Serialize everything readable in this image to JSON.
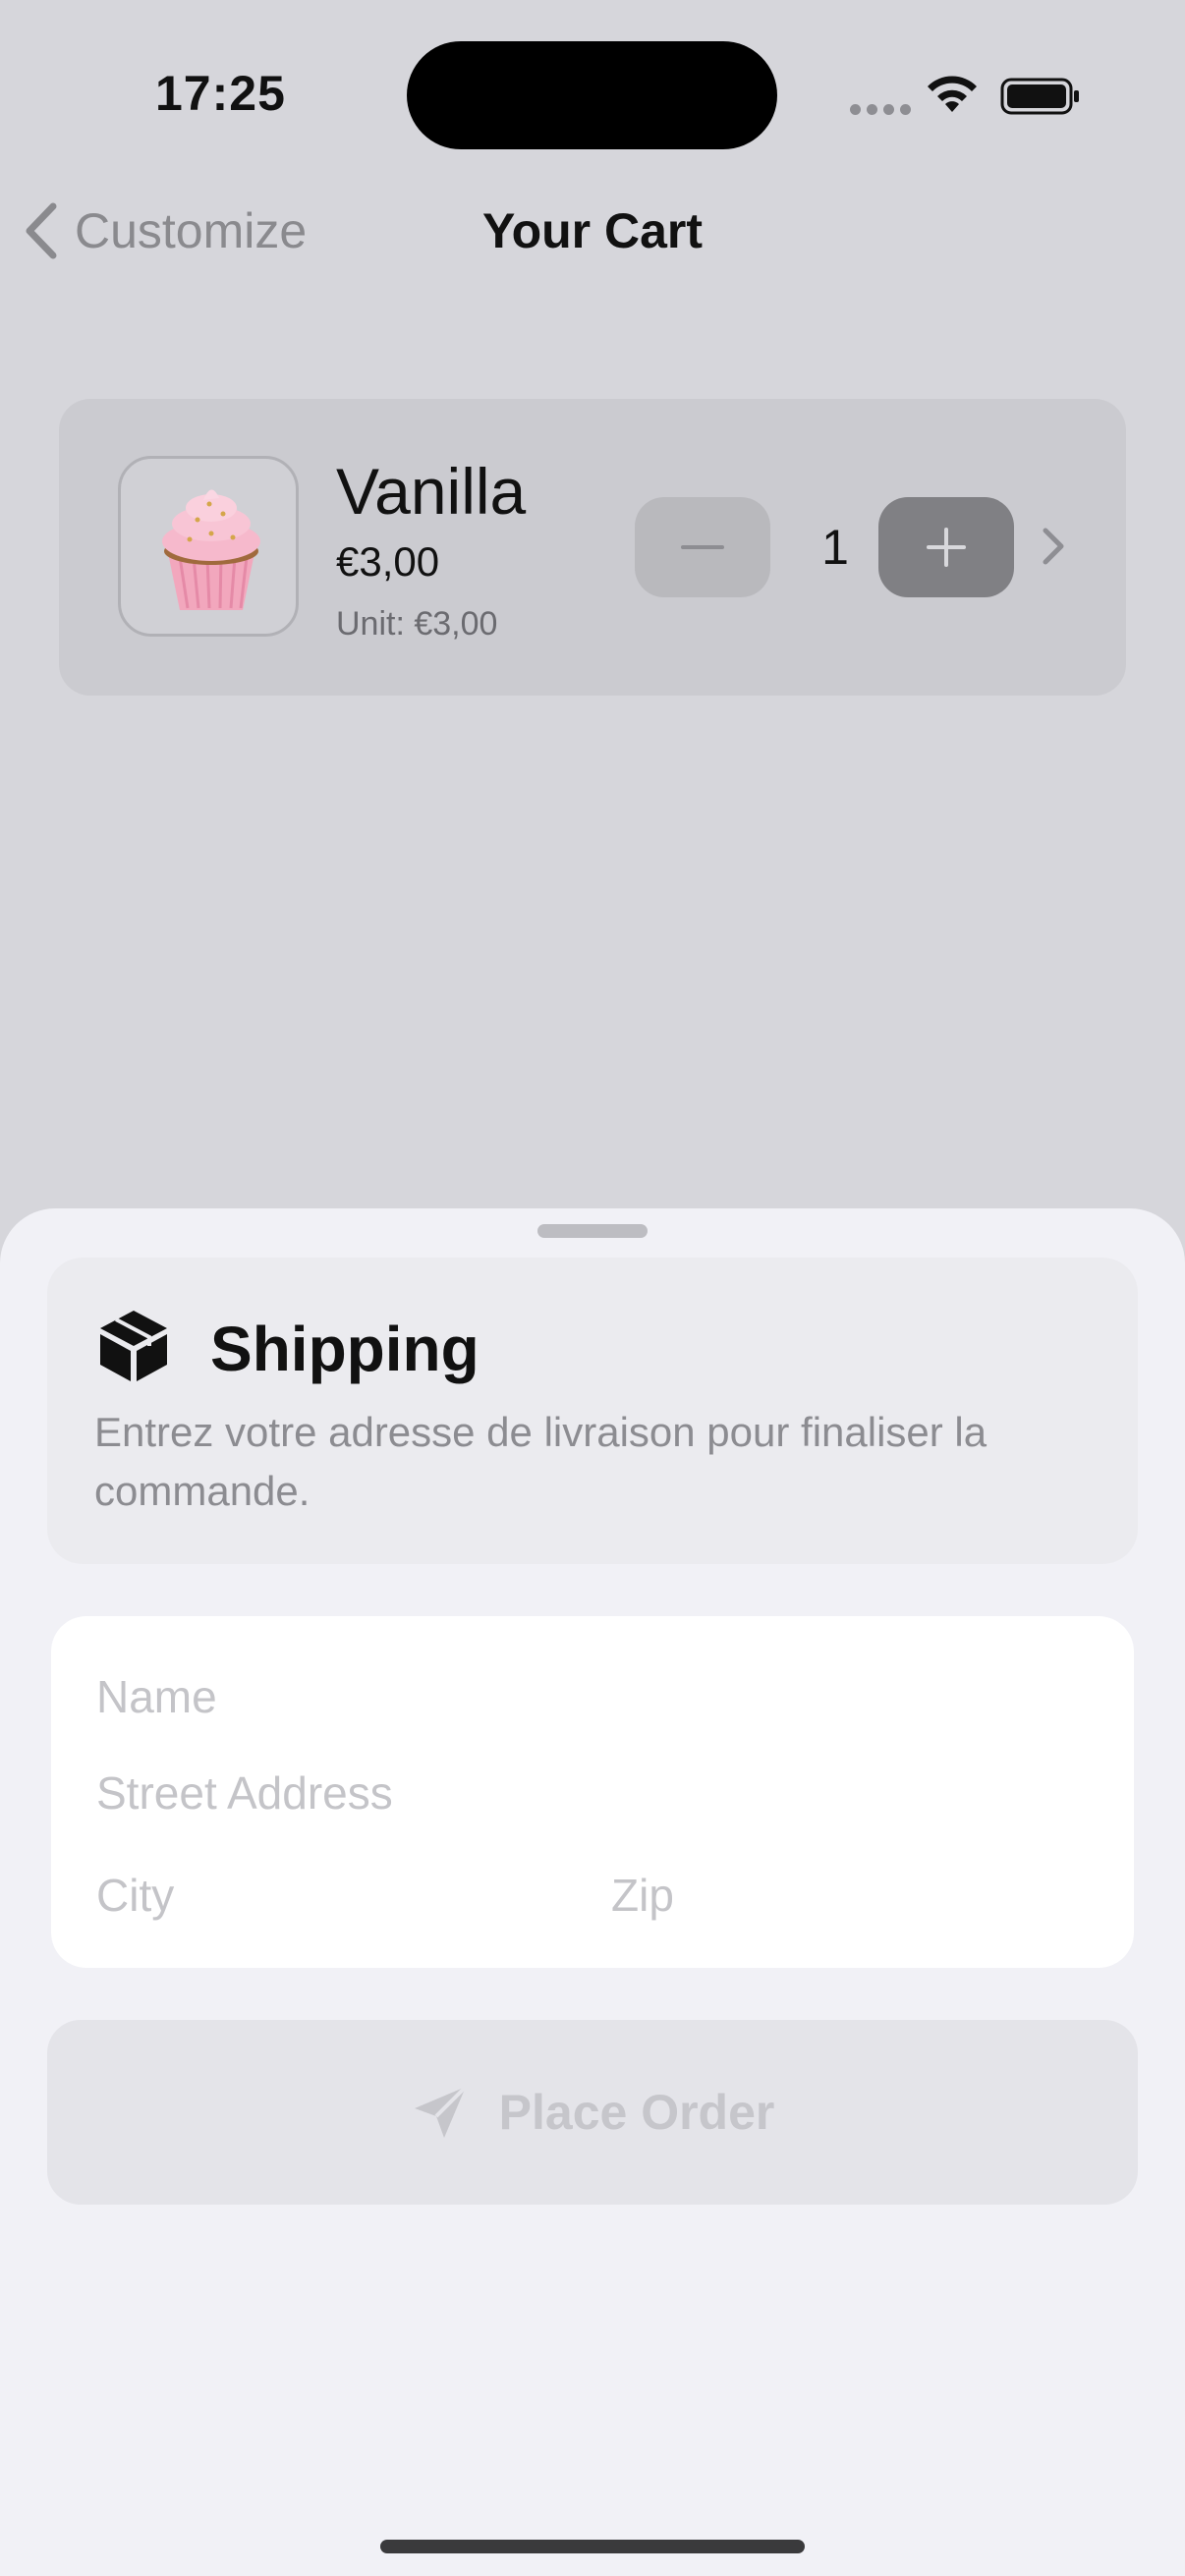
{
  "status_bar": {
    "time": "17:25"
  },
  "nav": {
    "back_label": "Customize",
    "title": "Your Cart"
  },
  "cart_item": {
    "name": "Vanilla",
    "price": "€3,00",
    "unit_price": "Unit: €3,00",
    "quantity": "1",
    "image_icon": "cupcake-icon"
  },
  "shipping": {
    "icon": "box-icon",
    "title": "Shipping",
    "description": "Entrez votre adresse de livraison pour finaliser la commande."
  },
  "form": {
    "name_placeholder": "Name",
    "street_placeholder": "Street Address",
    "city_placeholder": "City",
    "zip_placeholder": "Zip"
  },
  "actions": {
    "place_order_label": "Place Order",
    "place_order_icon": "send-icon"
  },
  "colors": {
    "background": "#d6d6db",
    "sheet": "#f1f1f6",
    "button_disabled": "#e4e4e9"
  }
}
